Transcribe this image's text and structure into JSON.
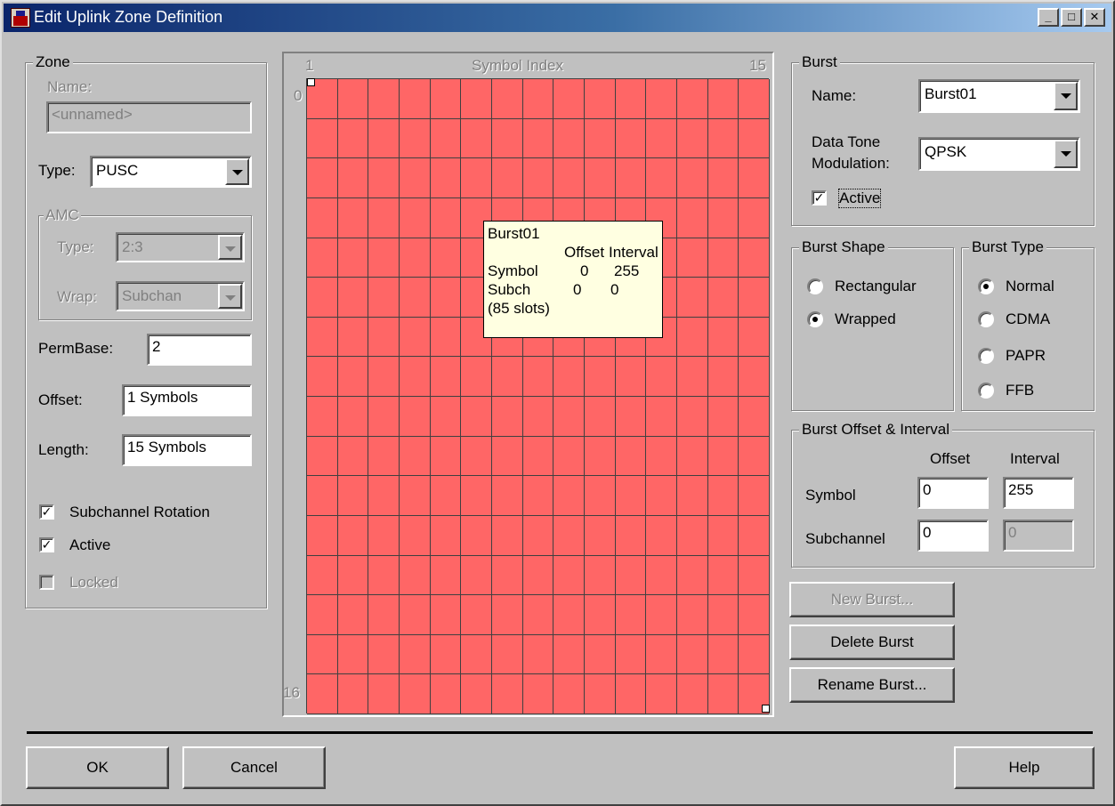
{
  "window": {
    "title": "Edit Uplink Zone Definition"
  },
  "zone": {
    "legend": "Zone",
    "name_label": "Name:",
    "name_value": "<unnamed>",
    "type_label": "Type:",
    "type_value": "PUSC",
    "amc": {
      "legend": "AMC",
      "type_label": "Type:",
      "type_value": "2:3",
      "wrap_label": "Wrap:",
      "wrap_value": "Subchan"
    },
    "permbase_label": "PermBase:",
    "permbase_value": "2",
    "offset_label": "Offset:",
    "offset_value": "1 Symbols",
    "length_label": "Length:",
    "length_value": "15 Symbols",
    "subchannel_rotation_label": "Subchannel Rotation",
    "subchannel_rotation_checked": true,
    "active_label": "Active",
    "active_checked": true,
    "locked_label": "Locked",
    "locked_checked": false
  },
  "grid": {
    "x_start": "1",
    "x_title": "Symbol Index",
    "x_end": "15",
    "y_start": "0",
    "y_end": "16",
    "columns": 15,
    "rows": 16,
    "cell_color": "#ff6666"
  },
  "tooltip": {
    "burst_name": "Burst01",
    "offset_header": "Offset",
    "interval_header": "Interval",
    "symbol_label": "Symbol",
    "symbol_offset": "0",
    "symbol_interval": "255",
    "subch_label": "Subch",
    "subch_offset": "0",
    "subch_interval": "0",
    "slots": "(85 slots)"
  },
  "burst": {
    "legend": "Burst",
    "name_label": "Name:",
    "name_value": "Burst01",
    "modulation_label_line1": "Data Tone",
    "modulation_label_line2": "Modulation:",
    "modulation_value": "QPSK",
    "active_label": "Active",
    "active_checked": true
  },
  "burst_shape": {
    "legend": "Burst Shape",
    "options": [
      "Rectangular",
      "Wrapped"
    ],
    "selected": "Wrapped"
  },
  "burst_type": {
    "legend": "Burst Type",
    "options": [
      "Normal",
      "CDMA",
      "PAPR",
      "FFB"
    ],
    "selected": "Normal"
  },
  "burst_offset": {
    "legend": "Burst Offset & Interval",
    "offset_header": "Offset",
    "interval_header": "Interval",
    "symbol_label": "Symbol",
    "symbol_offset": "0",
    "symbol_interval": "255",
    "subchannel_label": "Subchannel",
    "subchannel_offset": "0",
    "subchannel_interval": "0"
  },
  "buttons": {
    "new_burst": "New Burst...",
    "delete_burst": "Delete Burst",
    "rename_burst": "Rename Burst...",
    "ok": "OK",
    "cancel": "Cancel",
    "help": "Help"
  }
}
